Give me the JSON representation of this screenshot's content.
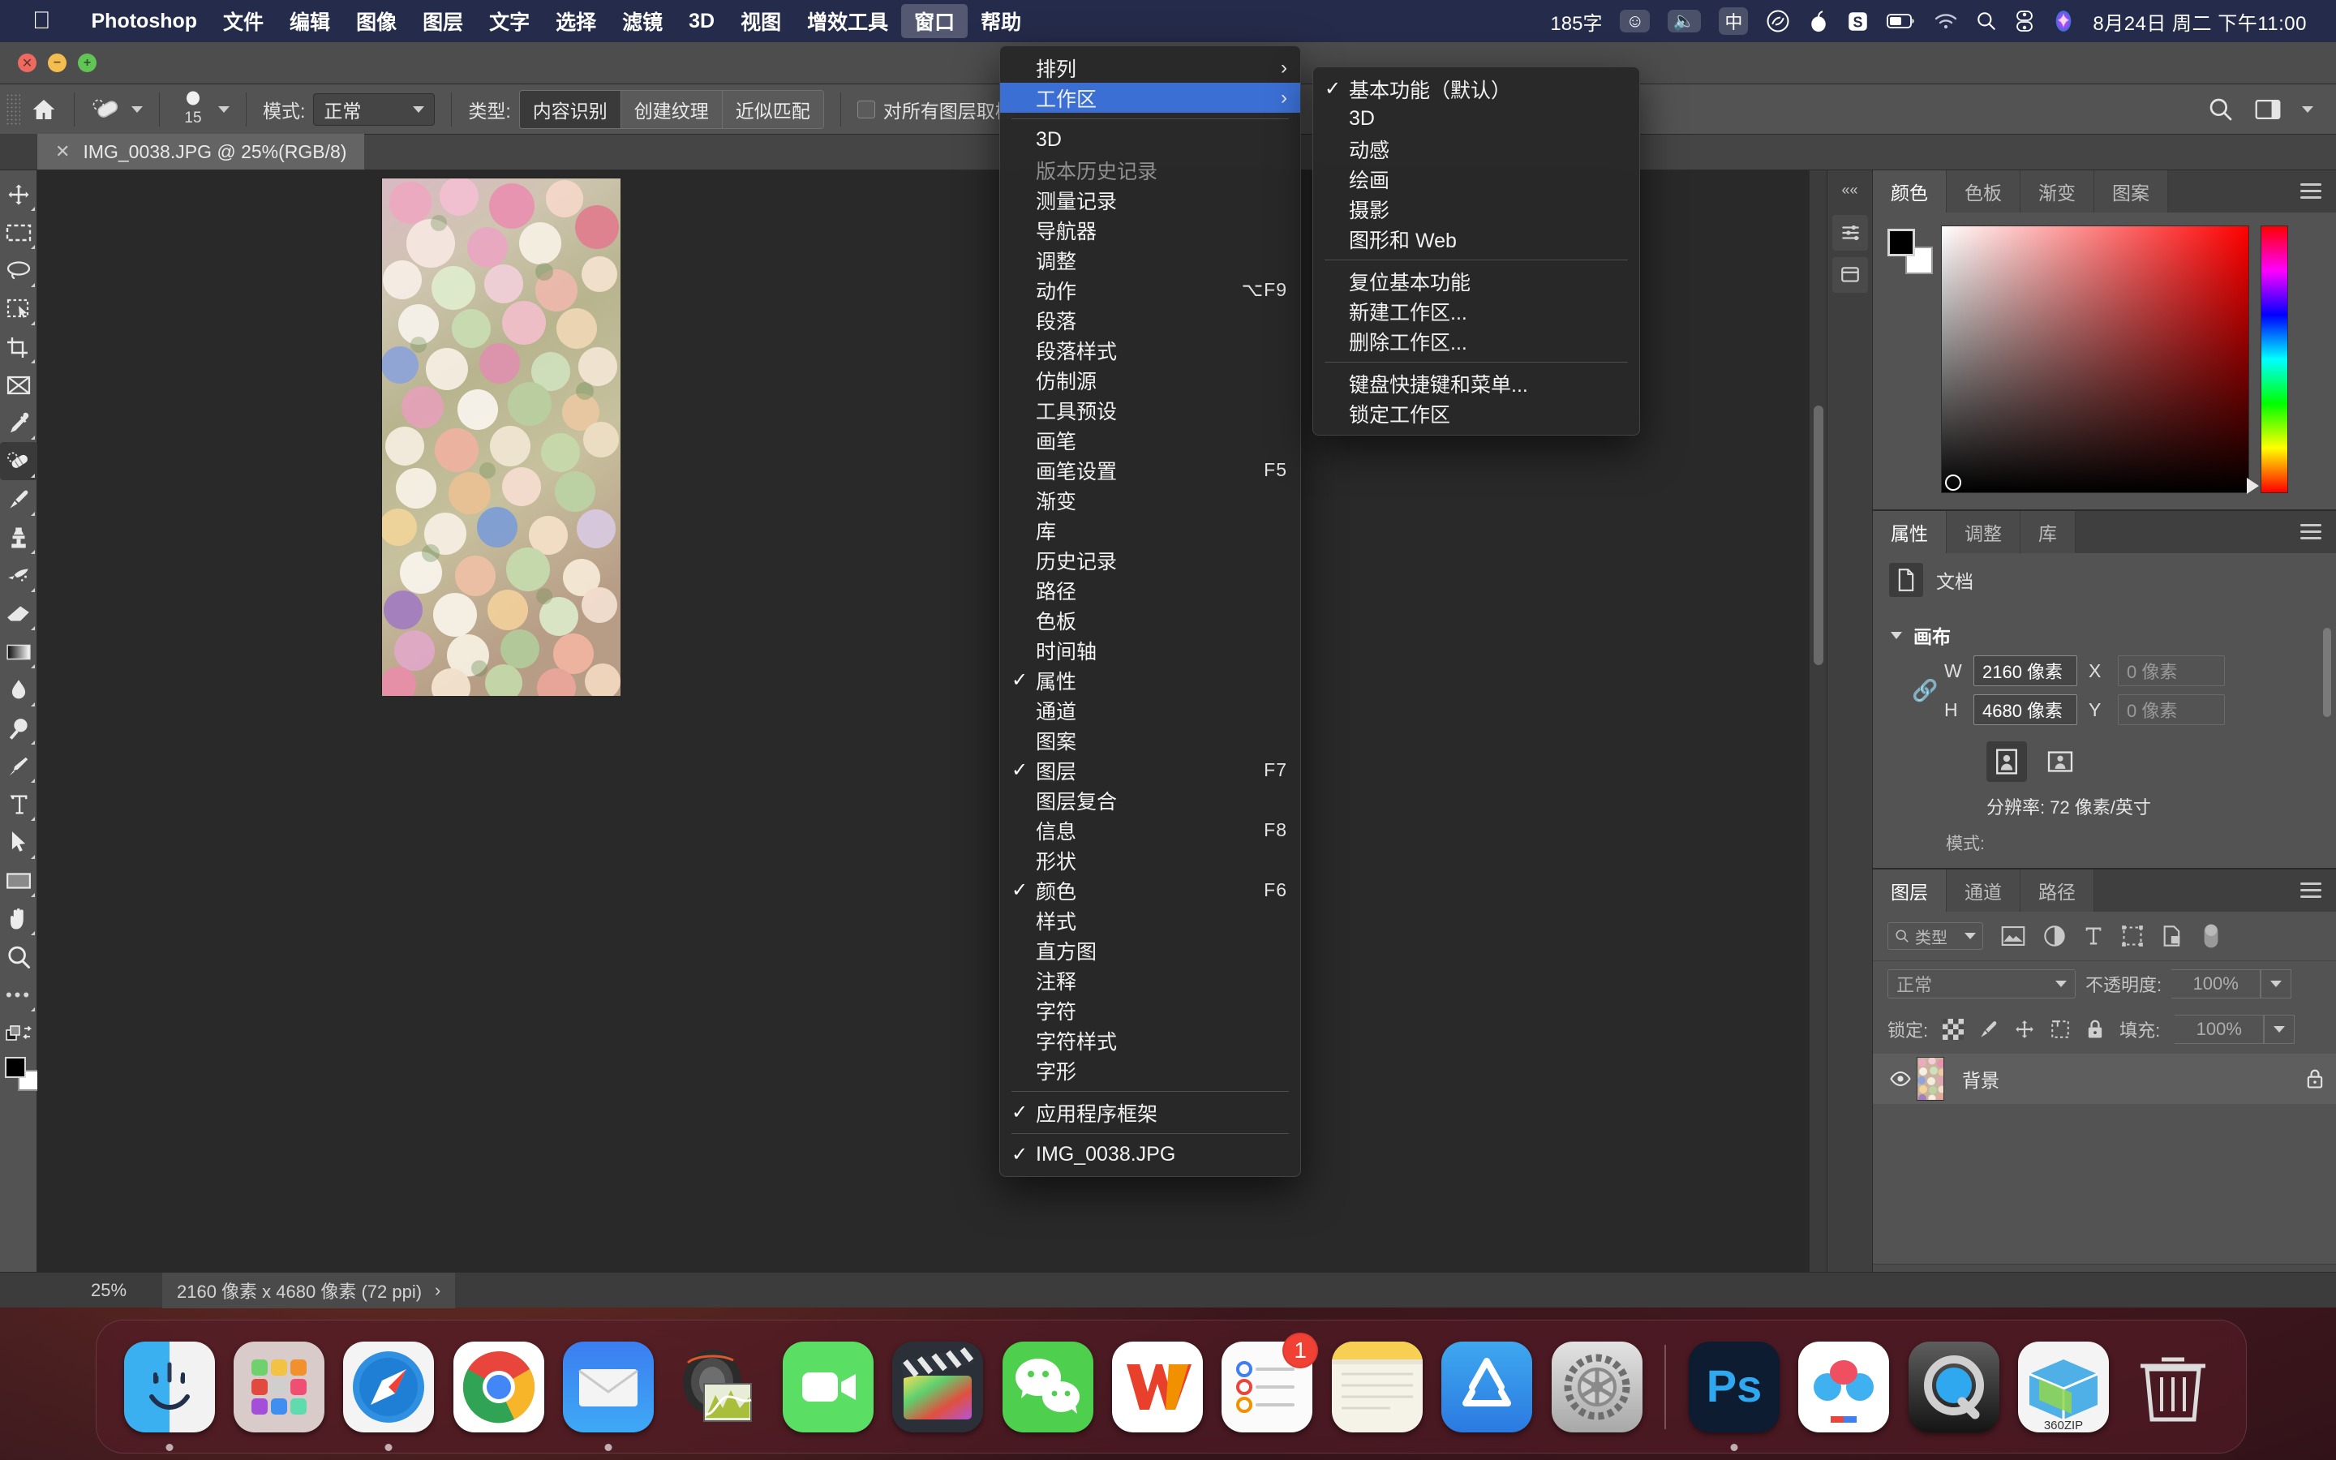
{
  "menubar": {
    "apple_icon": "apple-logo",
    "items": [
      {
        "label": "Photoshop",
        "bold": true
      },
      {
        "label": "文件"
      },
      {
        "label": "编辑"
      },
      {
        "label": "图像"
      },
      {
        "label": "图层"
      },
      {
        "label": "文字"
      },
      {
        "label": "选择"
      },
      {
        "label": "滤镜"
      },
      {
        "label": "3D"
      },
      {
        "label": "视图"
      },
      {
        "label": "增效工具"
      },
      {
        "label": "窗口",
        "active": true
      },
      {
        "label": "帮助"
      }
    ],
    "right": {
      "word_count": "185字",
      "emoji_icon": "smiley-face-icon",
      "mic_icon": "microphone-icon",
      "ime": "中",
      "creative_cloud_icon": "creative-cloud-icon",
      "app1_icon": "onion-app-icon",
      "sogou_icon": "sogou-s-icon",
      "battery_icon": "battery-icon",
      "wifi_icon": "wifi-icon",
      "search_icon": "spotlight-search-icon",
      "controlcenter_icon": "control-center-icon",
      "siri_icon": "siri-icon",
      "clock": "8月24日 周二 下午11:00"
    }
  },
  "titlebar": {
    "close": "close-button",
    "minimize": "minimize-button",
    "zoom": "zoom-button"
  },
  "options_bar": {
    "home_icon": "home-icon",
    "tool_icon": "spot-healing-brush-icon",
    "brush_size": "15",
    "mode_label": "模式:",
    "mode_value": "正常",
    "type_label": "类型:",
    "type_options": [
      {
        "label": "内容识别",
        "selected": true
      },
      {
        "label": "创建纹理",
        "selected": false
      },
      {
        "label": "近似匹配",
        "selected": false
      }
    ],
    "sample_all_layers": "对所有图层取样",
    "search_icon": "search-icon",
    "workspace_icon": "workspace-switch-icon",
    "chevron_icon": "chevron-down-icon"
  },
  "document_tab": {
    "close_icon": "close-tab-icon",
    "title": "IMG_0038.JPG @ 25%(RGB/8)"
  },
  "toolbar": {
    "tools": [
      {
        "name": "move-tool",
        "icon": "move-icon"
      },
      {
        "name": "marquee-tool",
        "icon": "rectangular-marquee-icon"
      },
      {
        "name": "lasso-tool",
        "icon": "lasso-icon"
      },
      {
        "name": "object-selection-tool",
        "icon": "object-selection-icon"
      },
      {
        "name": "crop-tool",
        "icon": "crop-icon"
      },
      {
        "name": "frame-tool",
        "icon": "frame-icon"
      },
      {
        "name": "eyedropper-tool",
        "icon": "eyedropper-icon"
      },
      {
        "name": "spot-healing-brush-tool",
        "icon": "healing-brush-icon",
        "selected": true
      },
      {
        "name": "brush-tool",
        "icon": "brush-icon"
      },
      {
        "name": "clone-stamp-tool",
        "icon": "clone-stamp-icon"
      },
      {
        "name": "history-brush-tool",
        "icon": "history-brush-icon"
      },
      {
        "name": "eraser-tool",
        "icon": "eraser-icon"
      },
      {
        "name": "gradient-tool",
        "icon": "gradient-icon"
      },
      {
        "name": "blur-tool",
        "icon": "blur-droplet-icon"
      },
      {
        "name": "dodge-tool",
        "icon": "dodge-icon"
      },
      {
        "name": "pen-tool",
        "icon": "pen-icon"
      },
      {
        "name": "type-tool",
        "icon": "text-t-icon"
      },
      {
        "name": "path-selection-tool",
        "icon": "path-arrow-icon"
      },
      {
        "name": "rectangle-tool",
        "icon": "rectangle-icon"
      },
      {
        "name": "hand-tool",
        "icon": "hand-icon"
      },
      {
        "name": "zoom-tool",
        "icon": "magnifier-icon"
      },
      {
        "name": "more-tools",
        "icon": "ellipsis-icon"
      }
    ],
    "quickmask_icon": "quick-mask-icon",
    "screenmode_icon": "screen-mode-icon",
    "foreground_color": "#000000",
    "background_color": "#ffffff"
  },
  "window_menu": {
    "items": [
      {
        "label": "排列",
        "submenu": true
      },
      {
        "label": "工作区",
        "submenu": true,
        "highlighted": true
      },
      {
        "separator": true
      },
      {
        "label": "3D"
      },
      {
        "label": "版本历史记录",
        "disabled": true
      },
      {
        "label": "测量记录"
      },
      {
        "label": "导航器"
      },
      {
        "label": "调整"
      },
      {
        "label": "动作",
        "shortcut": "⌥F9"
      },
      {
        "label": "段落"
      },
      {
        "label": "段落样式"
      },
      {
        "label": "仿制源"
      },
      {
        "label": "工具预设"
      },
      {
        "label": "画笔"
      },
      {
        "label": "画笔设置",
        "shortcut": "F5"
      },
      {
        "label": "渐变"
      },
      {
        "label": "库"
      },
      {
        "label": "历史记录"
      },
      {
        "label": "路径"
      },
      {
        "label": "色板"
      },
      {
        "label": "时间轴"
      },
      {
        "label": "属性",
        "checked": true
      },
      {
        "label": "通道"
      },
      {
        "label": "图案"
      },
      {
        "label": "图层",
        "checked": true,
        "shortcut": "F7"
      },
      {
        "label": "图层复合"
      },
      {
        "label": "信息",
        "shortcut": "F8"
      },
      {
        "label": "形状"
      },
      {
        "label": "颜色",
        "checked": true,
        "shortcut": "F6"
      },
      {
        "label": "样式"
      },
      {
        "label": "直方图"
      },
      {
        "label": "注释"
      },
      {
        "label": "字符"
      },
      {
        "label": "字符样式"
      },
      {
        "label": "字形"
      },
      {
        "separator": true
      },
      {
        "label": "应用程序框架",
        "checked": true
      },
      {
        "separator": true
      },
      {
        "label": "IMG_0038.JPG",
        "checked": true
      }
    ]
  },
  "workspace_submenu": {
    "items": [
      {
        "label": "基本功能（默认）",
        "checked": true
      },
      {
        "label": "3D"
      },
      {
        "label": "动感"
      },
      {
        "label": "绘画"
      },
      {
        "label": "摄影"
      },
      {
        "label": "图形和 Web"
      },
      {
        "separator": true
      },
      {
        "label": "复位基本功能"
      },
      {
        "label": "新建工作区..."
      },
      {
        "label": "删除工作区..."
      },
      {
        "separator": true
      },
      {
        "label": "键盘快捷键和菜单..."
      },
      {
        "label": "锁定工作区"
      }
    ]
  },
  "color_panel": {
    "tabs": [
      {
        "label": "颜色",
        "active": true
      },
      {
        "label": "色板",
        "active": false
      },
      {
        "label": "渐变",
        "active": false
      },
      {
        "label": "图案",
        "active": false
      }
    ],
    "menu_icon": "panel-menu-icon",
    "foreground": "#000000",
    "background": "#ffffff",
    "hue": "#ff0000"
  },
  "properties_panel": {
    "tabs": [
      {
        "label": "属性",
        "active": true
      },
      {
        "label": "调整",
        "active": false
      },
      {
        "label": "库",
        "active": false
      }
    ],
    "menu_icon": "panel-menu-icon",
    "doc_icon": "document-icon",
    "doc_label": "文档",
    "section_title": "画布",
    "link_icon": "link-chain-icon",
    "w_label": "W",
    "w_value": "2160 像素",
    "h_label": "H",
    "h_value": "4680 像素",
    "x_label": "X",
    "x_value": "0 像素",
    "y_label": "Y",
    "y_value": "0 像素",
    "orientation_portrait_icon": "portrait-orientation-icon",
    "orientation_landscape_icon": "landscape-orientation-icon",
    "resolution": "分辨率: 72 像素/英寸",
    "mode_label": "模式:"
  },
  "layers_panel": {
    "tabs": [
      {
        "label": "图层",
        "active": true
      },
      {
        "label": "通道",
        "active": false
      },
      {
        "label": "路径",
        "active": false
      }
    ],
    "menu_icon": "panel-menu-icon",
    "filter_label": "类型",
    "filter_icons": [
      "pixel-filter-icon",
      "adjustment-filter-icon",
      "type-filter-icon",
      "shape-filter-icon",
      "smartobject-filter-icon"
    ],
    "filter_toggle_icon": "filter-toggle-icon",
    "blend_mode": "正常",
    "opacity_label": "不透明度:",
    "opacity_value": "100%",
    "lock_label": "锁定:",
    "lock_icons": [
      "lock-transparency-icon",
      "lock-image-icon",
      "lock-position-icon",
      "lock-artboard-icon",
      "lock-all-icon"
    ],
    "fill_label": "填充:",
    "fill_value": "100%",
    "layers": [
      {
        "name": "背景",
        "visible": true,
        "locked": true,
        "thumb_icon": "layer-thumbnail"
      }
    ],
    "bottom_icons": [
      "link-layers-icon",
      "layer-style-fx-icon",
      "add-mask-icon",
      "adjustment-layer-icon",
      "new-group-icon",
      "new-layer-icon",
      "delete-layer-icon"
    ]
  },
  "statusbar": {
    "zoom": "25%",
    "dimensions": "2160 像素 x 4680 像素 (72 ppi)",
    "arrow_icon": "chevron-right-icon"
  },
  "dock": {
    "items": [
      {
        "name": "finder",
        "icon": "finder-icon",
        "running": true
      },
      {
        "name": "launchpad",
        "icon": "launchpad-icon",
        "running": false
      },
      {
        "name": "safari",
        "icon": "safari-icon",
        "running": true
      },
      {
        "name": "chrome",
        "icon": "chrome-icon",
        "running": false
      },
      {
        "name": "mail",
        "icon": "mail-icon",
        "running": true
      },
      {
        "name": "lightroom-classic",
        "icon": "camera-lens-icon",
        "running": false
      },
      {
        "name": "facetime",
        "icon": "facetime-icon",
        "running": false
      },
      {
        "name": "final-cut-pro",
        "icon": "clapperboard-icon",
        "running": false
      },
      {
        "name": "wechat",
        "icon": "wechat-icon",
        "running": false
      },
      {
        "name": "wps-office",
        "icon": "wps-w-icon",
        "running": false
      },
      {
        "name": "reminders",
        "icon": "reminders-icon",
        "badge": "1",
        "running": false
      },
      {
        "name": "notes",
        "icon": "notes-icon",
        "running": false
      },
      {
        "name": "app-store",
        "icon": "app-store-icon",
        "running": false
      },
      {
        "name": "system-preferences",
        "icon": "gear-icon",
        "running": false
      },
      {
        "name": "separator"
      },
      {
        "name": "photoshop",
        "icon": "photoshop-ps-icon",
        "running": true
      },
      {
        "name": "baidu-netdisk",
        "icon": "baidu-netdisk-icon",
        "running": false
      },
      {
        "name": "quicktime",
        "icon": "quicktime-q-icon",
        "running": false
      },
      {
        "name": "360zip",
        "icon": "360zip-icon",
        "label": "360ZIP",
        "running": false
      },
      {
        "name": "trash",
        "icon": "trash-icon",
        "running": false
      }
    ]
  }
}
